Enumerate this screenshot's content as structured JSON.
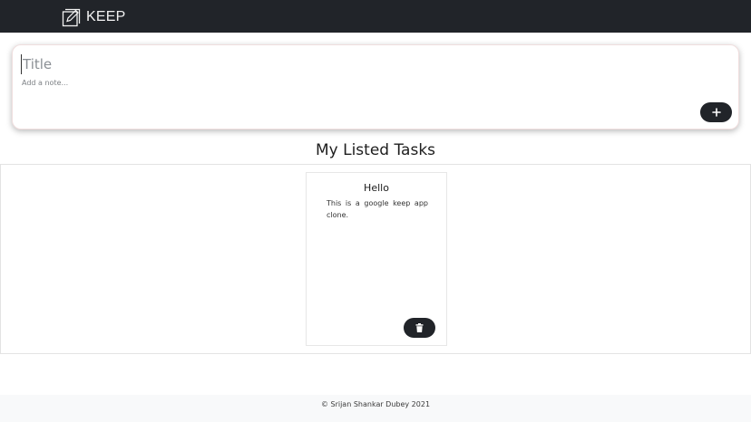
{
  "navbar": {
    "brand_icon": "edit-note-icon",
    "brand_text": "KEEP",
    "background": "#212429"
  },
  "note_form": {
    "title_placeholder": "Title",
    "note_placeholder": "Add a note...",
    "add_button_icon": "plus-icon"
  },
  "tasks": {
    "heading": "My Listed Tasks",
    "items": [
      {
        "title": "Hello",
        "body": "This is a google keep app clone.",
        "delete_icon": "trash-icon"
      }
    ]
  },
  "footer": {
    "text": "© Srijan Shankar Dubey 2021"
  }
}
